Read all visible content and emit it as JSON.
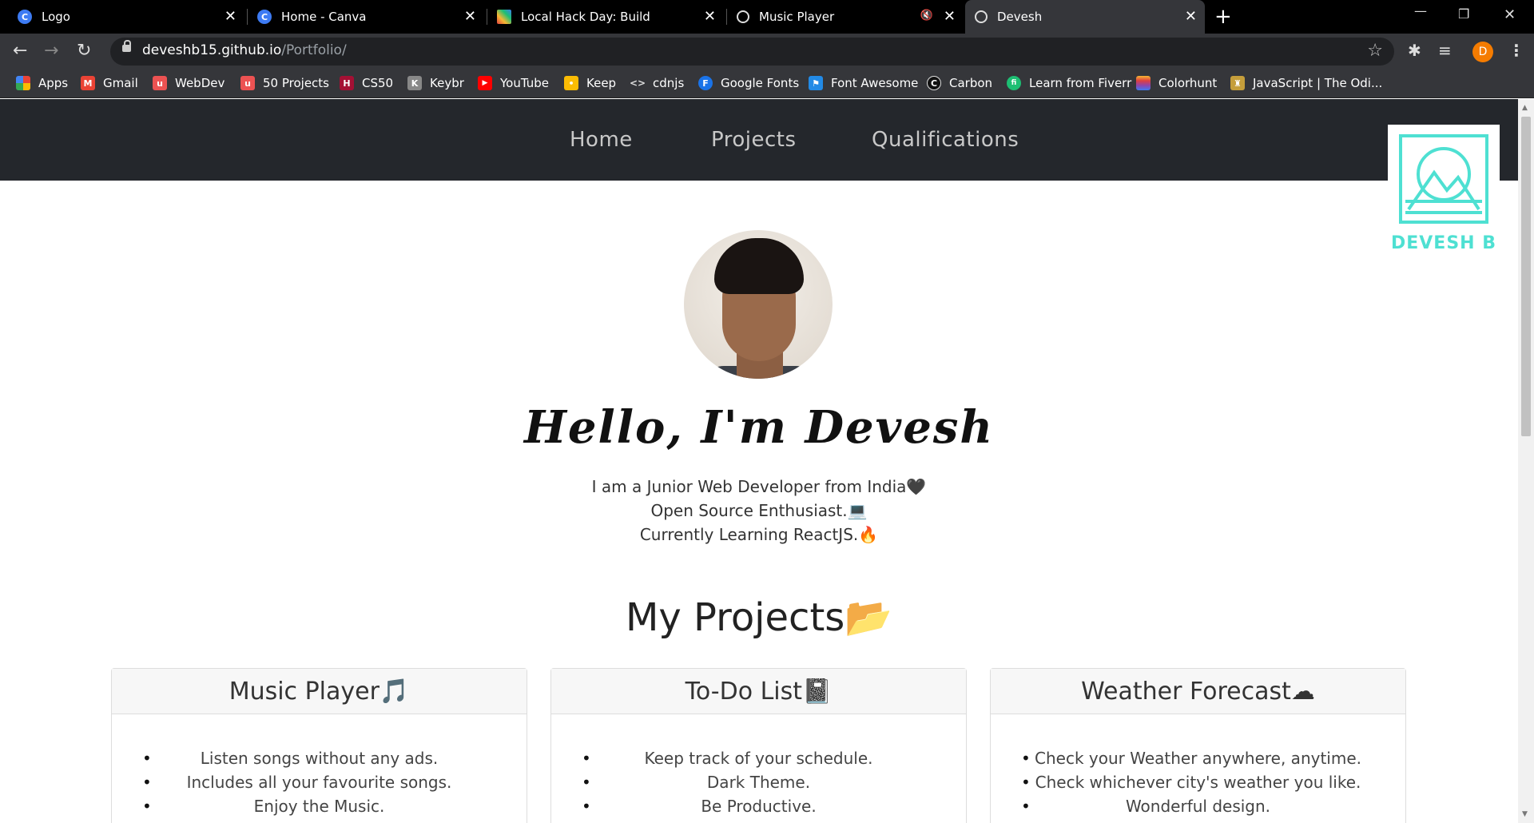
{
  "browser": {
    "tabs": [
      {
        "title": "Logo",
        "favicon": "canva-icon",
        "color": "#3d7bf3",
        "glyph": "C"
      },
      {
        "title": "Home - Canva",
        "favicon": "canva-icon",
        "color": "#3d7bf3",
        "glyph": "C"
      },
      {
        "title": "Local Hack Day: Build",
        "favicon": "mlh-icon",
        "color": "#e03f3f",
        "glyph": "⁄"
      },
      {
        "title": "Music Player",
        "favicon": "globe-icon",
        "color": "#000",
        "glyph": "🌐",
        "muted": true
      },
      {
        "title": "Devesh",
        "favicon": "globe-icon",
        "color": "#35363a",
        "glyph": "🌐",
        "active": true
      }
    ],
    "new_tab": "+",
    "window_controls": {
      "minimize": "—",
      "restore": "❐",
      "close": "✕"
    },
    "url_host": "deveshb15.github.io",
    "url_path": "/Portfolio/",
    "profile_initial": "D",
    "bookmarks": [
      {
        "label": "Apps",
        "icon": "apps-grid-icon",
        "color": "#e94335"
      },
      {
        "label": "Gmail",
        "icon": "gmail-icon",
        "color": "#ea4335",
        "glyph": "M"
      },
      {
        "label": "WebDev",
        "icon": "udemy-icon",
        "color": "#ec5252",
        "glyph": "u"
      },
      {
        "label": "50 Projects",
        "icon": "udemy-icon",
        "color": "#ec5252",
        "glyph": "u"
      },
      {
        "label": "CS50",
        "icon": "harvard-icon",
        "color": "#a41034",
        "glyph": "H"
      },
      {
        "label": "Keybr",
        "icon": "keybr-icon",
        "color": "#888888",
        "glyph": "K"
      },
      {
        "label": "YouTube",
        "icon": "youtube-icon",
        "color": "#ff0000",
        "glyph": "▶"
      },
      {
        "label": "Keep",
        "icon": "keep-icon",
        "color": "#fbbc04",
        "glyph": "•"
      },
      {
        "label": "cdnjs",
        "icon": "code-icon",
        "color": "#35363a",
        "glyph": "<>"
      },
      {
        "label": "Google Fonts",
        "icon": "google-fonts-icon",
        "color": "#1a73e8",
        "glyph": "F"
      },
      {
        "label": "Font Awesome",
        "icon": "flag-icon",
        "color": "#228ae6",
        "glyph": "⚑"
      },
      {
        "label": "Carbon",
        "icon": "carbon-icon",
        "color": "#111111",
        "glyph": "C"
      },
      {
        "label": "Learn from Fiverr",
        "icon": "fiverr-icon",
        "color": "#1dbf73",
        "glyph": "fi"
      },
      {
        "label": "Colorhunt",
        "icon": "colorhunt-icon",
        "color": "#8e44ad",
        "glyph": "◆"
      },
      {
        "label": "JavaScript | The Odi...",
        "icon": "odin-icon",
        "color": "#c59e3b",
        "glyph": "♜"
      }
    ]
  },
  "site": {
    "nav": [
      "Home",
      "Projects",
      "Qualifications"
    ],
    "logo_text": "DEVESH B",
    "accent": "#4ee0d2",
    "hero_title": "Hello, I'm Devesh",
    "intro_lines": [
      "I am a Junior Web Developer from India🖤",
      "Open Source Enthusiast.💻",
      "Currently Learning ReactJS.🔥"
    ],
    "projects_heading": "My Projects📂",
    "projects": [
      {
        "title": "Music Player🎵",
        "points": [
          "Listen songs without any ads.",
          "Includes all your favourite songs.",
          "Enjoy the Music."
        ]
      },
      {
        "title": "To-Do List📓",
        "points": [
          "Keep track of your schedule.",
          "Dark Theme.",
          "Be Productive."
        ]
      },
      {
        "title": "Weather Forecast☁",
        "points": [
          "Check your Weather anywhere, anytime.",
          "Check whichever city's weather you like.",
          "Wonderful design."
        ]
      }
    ]
  }
}
